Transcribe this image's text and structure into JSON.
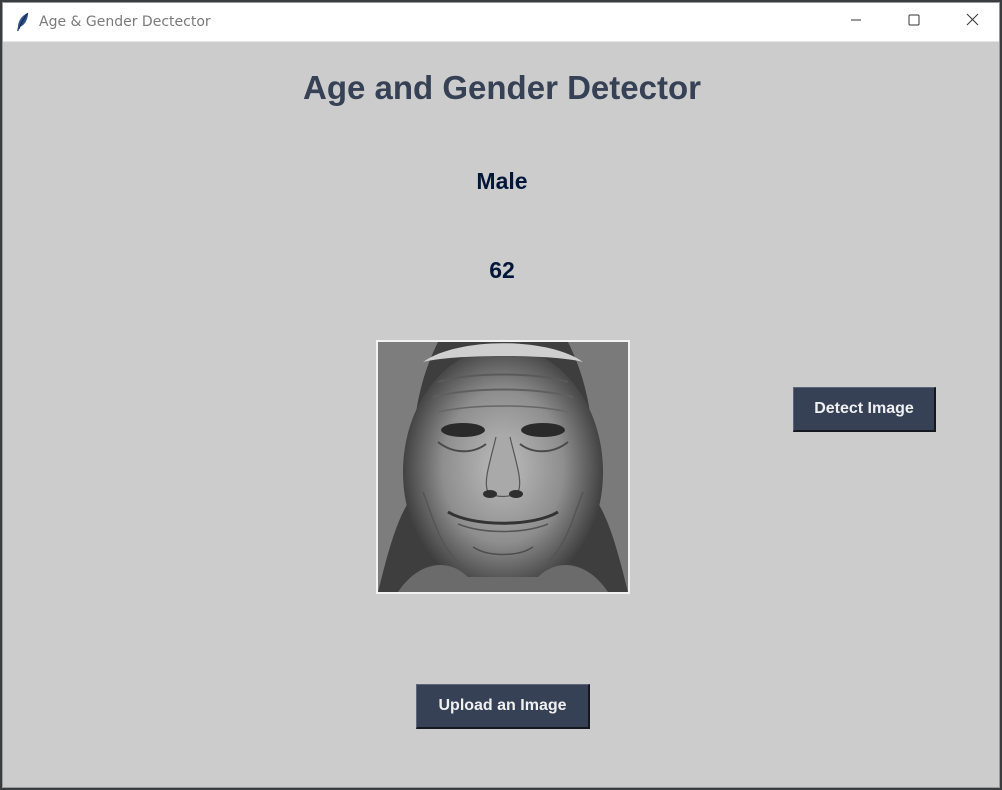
{
  "window": {
    "title": "Age & Gender Dectector",
    "icon": "feather-icon",
    "controls": [
      "minimize-icon",
      "maximize-icon",
      "close-icon"
    ]
  },
  "app": {
    "heading": "Age and Gender Detector",
    "gender_result": "Male",
    "age_result": "62",
    "detect_button_label": "Detect Image",
    "upload_button_label": "Upload an Image"
  },
  "colors": {
    "background": "#cccccc",
    "heading": "#364156",
    "result_text": "#011638",
    "button_bg": "#364156",
    "button_text": "#f0f0f0"
  }
}
